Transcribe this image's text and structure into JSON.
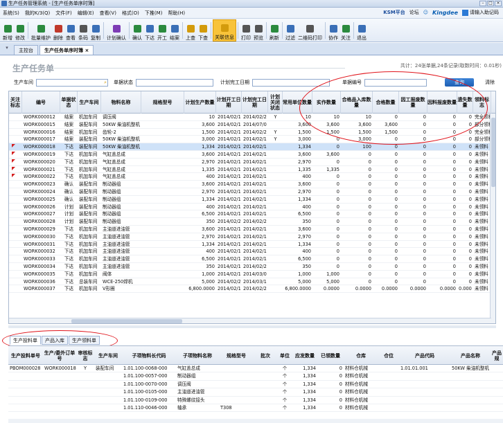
{
  "window": {
    "title": "生产任务管理系统 - [生产任务单序时簿]"
  },
  "menu": [
    "系统(S)",
    "我的K/3(Q)",
    "文件(F)",
    "编辑(E)",
    "查看(V)",
    "格式(O)",
    "下推(M)",
    "帮助(H)"
  ],
  "menu_right": {
    "platform": "KSM平台",
    "forum": "论坛",
    "brand": "Kingdee",
    "notice": "请输入助记码"
  },
  "toolbar": [
    "新增",
    "修改",
    "批量维护",
    "删除",
    "查看",
    "条码",
    "复制",
    "计划确认",
    "确认",
    "下达",
    "开工",
    "结案",
    "上查",
    "下查",
    "关联信息",
    "打印",
    "预览",
    "刷新",
    "过滤",
    "二维码打印",
    "协作",
    "关注",
    "退出"
  ],
  "toolbar_active": "关联信息",
  "tabs": {
    "home": "主控台",
    "current": "生产任务单序时簿"
  },
  "page": {
    "title": "生产任务单",
    "summary": "共计：24张单据,24条记录(取数时间：0.01秒)"
  },
  "filter": {
    "workshop_label": "生产车间",
    "status_label": "单据状态",
    "finish_label": "计划完工日期",
    "bill_label": "单据编号",
    "query_btn": "查询",
    "clear_btn": "清除"
  },
  "grid": {
    "columns": [
      "关注标志",
      "编号",
      "单据状态",
      "生产车间",
      "物料名称",
      "规格型号",
      "计划生产数量",
      "计划开工日期",
      "计划完工日期",
      "计划关闭状态",
      "常用单位数量",
      "实作数量",
      "合格品入库数量",
      "合格数量",
      "因工报废数量",
      "因料报废数量",
      "遗失数量",
      "领料标志"
    ],
    "rows": [
      {
        "flag": false,
        "no": "WORK000012",
        "status": "结案",
        "shop": "机加车间",
        "item": "调压阀",
        "spec": "",
        "qty": "10",
        "start": "2014/02/12",
        "end": "2014/02/28",
        "close": "Y",
        "unit_qty": "10",
        "actual": "10",
        "in_qty": "10",
        "ok": "0",
        "scrap_w": "0",
        "scrap_m": "0",
        "lost": "0",
        "pick": "完全领料"
      },
      {
        "flag": false,
        "no": "WORK000015",
        "status": "结案",
        "shop": "装配车间",
        "item": "50KW 柴油机整机",
        "spec": "",
        "qty": "3,600",
        "start": "2014/02/18",
        "end": "2014/07/07",
        "close": "",
        "unit_qty": "3,600",
        "actual": "3,600",
        "in_qty": "3,600",
        "ok": "3,600",
        "scrap_w": "0",
        "scrap_m": "0",
        "lost": "0",
        "pick": "部分领料"
      },
      {
        "flag": false,
        "no": "WORK000016",
        "status": "结案",
        "shop": "机加车间",
        "item": "齿轮-2",
        "spec": "",
        "qty": "1,500",
        "start": "2014/02/12",
        "end": "2014/02/20",
        "close": "Y",
        "unit_qty": "1,500",
        "actual": "1,500",
        "in_qty": "1,500",
        "ok": "1,500",
        "scrap_w": "0",
        "scrap_m": "0",
        "lost": "0",
        "pick": "完全领料"
      },
      {
        "flag": false,
        "no": "WORK000017",
        "status": "结案",
        "shop": "装配车间",
        "item": "50KW 柴油机整机",
        "spec": "",
        "qty": "3,000",
        "start": "2014/02/12",
        "end": "2014/02/12",
        "close": "Y",
        "unit_qty": "3,000",
        "actual": "0",
        "in_qty": "3,000",
        "ok": "0",
        "scrap_w": "0",
        "scrap_m": "0",
        "lost": "0",
        "pick": "部分领料"
      },
      {
        "flag": true,
        "no": "WORK000018",
        "status": "下达",
        "shop": "装配车间",
        "item": "50KW 柴油机整机",
        "spec": "",
        "qty": "1,334",
        "start": "2014/02/12",
        "end": "2014/02/17",
        "close": "",
        "unit_qty": "1,334",
        "actual": "0",
        "in_qty": "100",
        "ok": "0",
        "scrap_w": "0",
        "scrap_m": "0",
        "lost": "0",
        "pick": "未领料",
        "sel": true
      },
      {
        "flag": true,
        "no": "WORK000019",
        "status": "下达",
        "shop": "机加车间",
        "item": "气缸盖总成",
        "spec": "",
        "qty": "3,600",
        "start": "2014/02/12",
        "end": "2014/02/12",
        "close": "",
        "unit_qty": "3,600",
        "actual": "3,600",
        "in_qty": "0",
        "ok": "0",
        "scrap_w": "0",
        "scrap_m": "0",
        "lost": "0",
        "pick": "未领料"
      },
      {
        "flag": true,
        "no": "WORK000020",
        "status": "下达",
        "shop": "机加车间",
        "item": "气缸盖总成",
        "spec": "",
        "qty": "2,970",
        "start": "2014/02/12",
        "end": "2014/02/12",
        "close": "",
        "unit_qty": "2,970",
        "actual": "0",
        "in_qty": "0",
        "ok": "0",
        "scrap_w": "0",
        "scrap_m": "0",
        "lost": "0",
        "pick": "未领料"
      },
      {
        "flag": true,
        "no": "WORK000021",
        "status": "下达",
        "shop": "机加车间",
        "item": "气缸盖总成",
        "spec": "",
        "qty": "1,335",
        "start": "2014/02/12",
        "end": "2014/02/12",
        "close": "",
        "unit_qty": "1,335",
        "actual": "1,335",
        "in_qty": "0",
        "ok": "0",
        "scrap_w": "0",
        "scrap_m": "0",
        "lost": "0",
        "pick": "未领料"
      },
      {
        "flag": true,
        "no": "WORK000022",
        "status": "下达",
        "shop": "机加车间",
        "item": "气缸盖总成",
        "spec": "",
        "qty": "400",
        "start": "2014/02/12",
        "end": "2014/02/12",
        "close": "",
        "unit_qty": "400",
        "actual": "0",
        "in_qty": "0",
        "ok": "0",
        "scrap_w": "0",
        "scrap_m": "0",
        "lost": "0",
        "pick": "未领料"
      },
      {
        "flag": false,
        "no": "WORK000023",
        "status": "确认",
        "shop": "装配车间",
        "item": "制动器组",
        "spec": "",
        "qty": "3,600",
        "start": "2014/02/12",
        "end": "2014/02/12",
        "close": "",
        "unit_qty": "3,600",
        "actual": "0",
        "in_qty": "0",
        "ok": "0",
        "scrap_w": "0",
        "scrap_m": "0",
        "lost": "0",
        "pick": "未领料"
      },
      {
        "flag": false,
        "no": "WORK000024",
        "status": "确认",
        "shop": "装配车间",
        "item": "制动器组",
        "spec": "",
        "qty": "2,970",
        "start": "2014/02/12",
        "end": "2014/02/12",
        "close": "",
        "unit_qty": "2,970",
        "actual": "0",
        "in_qty": "0",
        "ok": "0",
        "scrap_w": "0",
        "scrap_m": "0",
        "lost": "0",
        "pick": "未领料"
      },
      {
        "flag": false,
        "no": "WORK000025",
        "status": "确认",
        "shop": "装配车间",
        "item": "制动器组",
        "spec": "",
        "qty": "1,334",
        "start": "2014/02/12",
        "end": "2014/02/12",
        "close": "",
        "unit_qty": "1,334",
        "actual": "0",
        "in_qty": "0",
        "ok": "0",
        "scrap_w": "0",
        "scrap_m": "0",
        "lost": "0",
        "pick": "未领料"
      },
      {
        "flag": false,
        "no": "WORK000026",
        "status": "计划",
        "shop": "装配车间",
        "item": "制动器组",
        "spec": "",
        "qty": "400",
        "start": "2014/02/12",
        "end": "2014/02/12",
        "close": "",
        "unit_qty": "400",
        "actual": "0",
        "in_qty": "0",
        "ok": "0",
        "scrap_w": "0",
        "scrap_m": "0",
        "lost": "0",
        "pick": "未领料"
      },
      {
        "flag": false,
        "no": "WORK000027",
        "status": "计划",
        "shop": "装配车间",
        "item": "制动器组",
        "spec": "",
        "qty": "6,500",
        "start": "2014/02/12",
        "end": "2014/02/12",
        "close": "",
        "unit_qty": "6,500",
        "actual": "0",
        "in_qty": "0",
        "ok": "0",
        "scrap_w": "0",
        "scrap_m": "0",
        "lost": "0",
        "pick": "未领料"
      },
      {
        "flag": false,
        "no": "WORK000028",
        "status": "计划",
        "shop": "装配车间",
        "item": "制动器组",
        "spec": "",
        "qty": "350",
        "start": "2014/02/24",
        "end": "2014/02/26",
        "close": "",
        "unit_qty": "350",
        "actual": "0",
        "in_qty": "0",
        "ok": "0",
        "scrap_w": "0",
        "scrap_m": "0",
        "lost": "0",
        "pick": "未领料"
      },
      {
        "flag": false,
        "no": "WORK000029",
        "status": "下达",
        "shop": "机加车间",
        "item": "主油道进油管",
        "spec": "",
        "qty": "3,600",
        "start": "2014/02/12",
        "end": "2014/02/12",
        "close": "",
        "unit_qty": "3,600",
        "actual": "0",
        "in_qty": "0",
        "ok": "0",
        "scrap_w": "0",
        "scrap_m": "0",
        "lost": "0",
        "pick": "未领料"
      },
      {
        "flag": false,
        "no": "WORK000030",
        "status": "下达",
        "shop": "机加车间",
        "item": "主油道进油管",
        "spec": "",
        "qty": "2,970",
        "start": "2014/02/12",
        "end": "2014/02/12",
        "close": "",
        "unit_qty": "2,970",
        "actual": "0",
        "in_qty": "0",
        "ok": "0",
        "scrap_w": "0",
        "scrap_m": "0",
        "lost": "0",
        "pick": "未领料"
      },
      {
        "flag": false,
        "no": "WORK000031",
        "status": "下达",
        "shop": "机加车间",
        "item": "主油道进油管",
        "spec": "",
        "qty": "1,334",
        "start": "2014/02/12",
        "end": "2014/02/12",
        "close": "",
        "unit_qty": "1,334",
        "actual": "0",
        "in_qty": "0",
        "ok": "0",
        "scrap_w": "0",
        "scrap_m": "0",
        "lost": "0",
        "pick": "未领料"
      },
      {
        "flag": false,
        "no": "WORK000032",
        "status": "下达",
        "shop": "机加车间",
        "item": "主油道进油管",
        "spec": "",
        "qty": "400",
        "start": "2014/02/12",
        "end": "2014/02/12",
        "close": "",
        "unit_qty": "400",
        "actual": "0",
        "in_qty": "0",
        "ok": "0",
        "scrap_w": "0",
        "scrap_m": "0",
        "lost": "0",
        "pick": "未领料"
      },
      {
        "flag": false,
        "no": "WORK000033",
        "status": "下达",
        "shop": "机加车间",
        "item": "主油道进油管",
        "spec": "",
        "qty": "6,500",
        "start": "2014/02/12",
        "end": "2014/02/12",
        "close": "",
        "unit_qty": "6,500",
        "actual": "0",
        "in_qty": "0",
        "ok": "0",
        "scrap_w": "0",
        "scrap_m": "0",
        "lost": "0",
        "pick": "未领料"
      },
      {
        "flag": false,
        "no": "WORK000034",
        "status": "下达",
        "shop": "机加车间",
        "item": "主油道进油管",
        "spec": "",
        "qty": "350",
        "start": "2014/02/12",
        "end": "2014/02/26",
        "close": "",
        "unit_qty": "350",
        "actual": "0",
        "in_qty": "0",
        "ok": "0",
        "scrap_w": "0",
        "scrap_m": "0",
        "lost": "0",
        "pick": "未领料"
      },
      {
        "flag": false,
        "no": "WORK000035",
        "status": "下达",
        "shop": "机加车间",
        "item": "阀体",
        "spec": "",
        "qty": "1,000",
        "start": "2014/02/19",
        "end": "2014/03/05",
        "close": "",
        "unit_qty": "1,000",
        "actual": "1,000",
        "in_qty": "0",
        "ok": "0",
        "scrap_w": "0",
        "scrap_m": "0",
        "lost": "0",
        "pick": "未领料"
      },
      {
        "flag": false,
        "no": "WORK000036",
        "status": "下达",
        "shop": "总装车间",
        "item": "WCE-250焊机",
        "spec": "",
        "qty": "5,000",
        "start": "2014/02/25",
        "end": "2014/03/10",
        "close": "",
        "unit_qty": "5,000",
        "actual": "5,000",
        "in_qty": "0",
        "ok": "0",
        "scrap_w": "0",
        "scrap_m": "0",
        "lost": "0",
        "pick": "未领料"
      },
      {
        "flag": false,
        "no": "WORK000037",
        "status": "下达",
        "shop": "机加车间",
        "item": "V形圈",
        "spec": "",
        "qty": "6,800.0000",
        "start": "2014/02/19",
        "end": "2014/02/28",
        "close": "",
        "unit_qty": "6,800.0000",
        "actual": "0.0000",
        "in_qty": "0.0000",
        "ok": "0.0000",
        "scrap_w": "0.0000",
        "scrap_m": "0.0000",
        "lost": "0.0000",
        "pick": "未领料"
      }
    ]
  },
  "subtabs": [
    "生产投料单",
    "产品入库",
    "生产领料单"
  ],
  "detail": {
    "columns": [
      "生产投料单号",
      "生产/委外订单号",
      "审核标志",
      "生产车间",
      "子项物料长代码",
      "子项物料名称",
      "规格型号",
      "批次",
      "单位",
      "应发数量",
      "已领数量",
      "仓库",
      "仓位",
      "产品代码",
      "产品名称",
      "产品规"
    ],
    "rows": [
      {
        "bill": "PBOM000028",
        "order": "WORK000018",
        "audit": "Y",
        "shop": "装配车间",
        "code": "1.01.100-0068-000",
        "name": "气缸盖总成",
        "spec": "",
        "unit": "个",
        "qty": "1,334",
        "got": "0",
        "wh": "材料仓机械",
        "pcode": "1.01.01.001",
        "pname": "50KW 柴油机整机"
      },
      {
        "bill": "",
        "order": "",
        "audit": "",
        "shop": "",
        "code": "1.01.100-0057-000",
        "name": "制动器组",
        "spec": "",
        "unit": "个",
        "qty": "1,334",
        "got": "0",
        "wh": "材料仓机械",
        "pcode": "",
        "pname": ""
      },
      {
        "bill": "",
        "order": "",
        "audit": "",
        "shop": "",
        "code": "1.01.100-0070-000",
        "name": "调压阀",
        "spec": "",
        "unit": "个",
        "qty": "1,334",
        "got": "0",
        "wh": "材料仓机械",
        "pcode": "",
        "pname": ""
      },
      {
        "bill": "",
        "order": "",
        "audit": "",
        "shop": "",
        "code": "1.01.100-0105-000",
        "name": "主油道进油管",
        "spec": "",
        "unit": "个",
        "qty": "1,334",
        "got": "0",
        "wh": "材料仓机械",
        "pcode": "",
        "pname": ""
      },
      {
        "bill": "",
        "order": "",
        "audit": "",
        "shop": "",
        "code": "1.01.100-0109-000",
        "name": "特殊螺纹接头",
        "spec": "",
        "unit": "个",
        "qty": "1,334",
        "got": "0",
        "wh": "材料仓机械",
        "pcode": "",
        "pname": ""
      },
      {
        "bill": "",
        "order": "",
        "audit": "",
        "shop": "",
        "code": "1.01.110-0046-000",
        "name": "轴承",
        "spec": "T308",
        "unit": "个",
        "qty": "1,334",
        "got": "0",
        "wh": "材料仓机械",
        "pcode": "",
        "pname": ""
      }
    ]
  }
}
